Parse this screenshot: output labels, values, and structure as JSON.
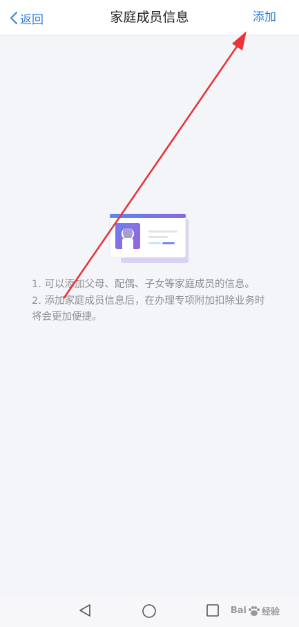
{
  "nav": {
    "back_label": "返回",
    "title": "家庭成员信息",
    "add_label": "添加"
  },
  "tips": {
    "line1": "1. 可以添加父母、配偶、子女等家庭成员的信息。",
    "line2": "2. 添加家庭成员信息后，在办理专项附加扣除业务时将会更加便捷。"
  },
  "system_nav": {
    "back_icon": "triangle-back-icon",
    "home_icon": "circle-home-icon",
    "recents_icon": "square-recents-icon"
  },
  "watermark": {
    "text_left": "Bai",
    "text_right": "经验"
  },
  "colors": {
    "accent": "#2f7fde",
    "background": "#f4f5f9",
    "annotation_arrow": "#e8343b"
  }
}
